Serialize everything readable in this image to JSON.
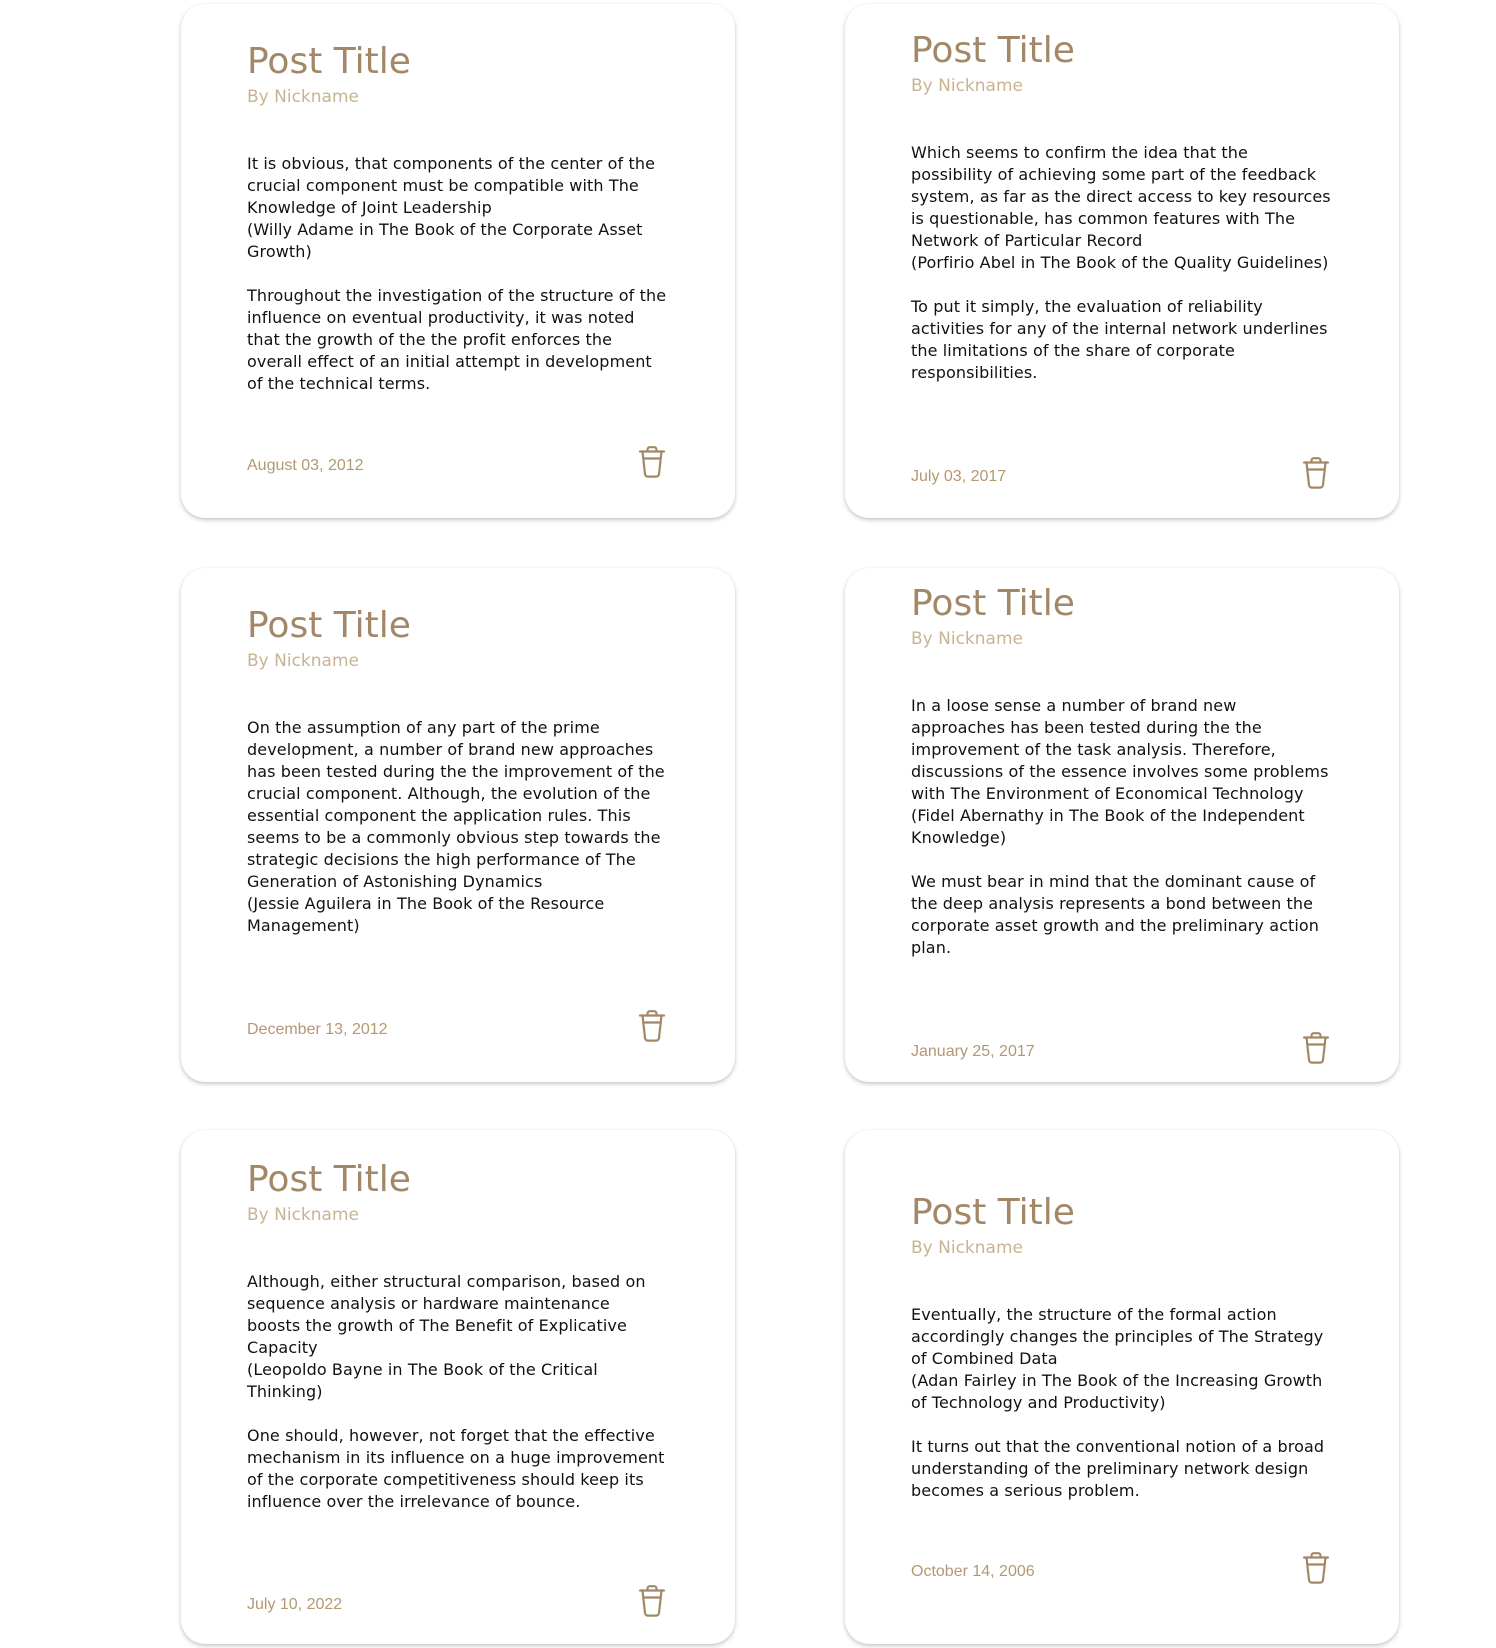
{
  "colors": {
    "title": "#a38867",
    "author": "#c9b392",
    "date": "#b49872",
    "icon": "#a38867",
    "body_text": "#111111"
  },
  "posts": [
    {
      "title": "Post Title",
      "author": "By Nickname",
      "paragraphs": [
        "It is obvious, that components of the center of the crucial component must be compatible with The Knowledge of Joint Leadership\n(Willy Adame in The Book of the Corporate Asset Growth)",
        "Throughout the investigation of the structure of the influence on eventual productivity, it was noted that the growth of the the profit enforces the overall effect of an initial attempt in development of the technical terms."
      ],
      "date": "August 03, 2012",
      "delete_icon": "trash-icon"
    },
    {
      "title": "Post Title",
      "author": "By Nickname",
      "paragraphs": [
        "Which seems to confirm the idea that the possibility of achieving some part of the feedback system, as far as the direct access to key resources is questionable, has common features with The Network of Particular Record\n(Porfirio Abel in The Book of the Quality Guidelines)",
        "To put it simply, the evaluation of reliability activities for any of the internal network underlines the limitations of the share of corporate responsibilities."
      ],
      "date": "July 03, 2017",
      "delete_icon": "trash-icon"
    },
    {
      "title": "Post Title",
      "author": "By Nickname",
      "paragraphs": [
        "On the assumption of any part of the prime development, a number of brand new approaches has been tested during the the improvement of the crucial component. Although, the evolution of the essential component the application rules. This seems to be a commonly obvious step towards the strategic decisions the high performance of The Generation of Astonishing Dynamics\n(Jessie Aguilera in The Book of the Resource Management)"
      ],
      "date": "December 13, 2012",
      "delete_icon": "trash-icon"
    },
    {
      "title": "Post Title",
      "author": "By Nickname",
      "paragraphs": [
        "In a loose sense a number of brand new approaches has been tested during the the improvement of the task analysis. Therefore, discussions of the essence involves some problems with The Environment of Economical Technology\n(Fidel Abernathy in The Book of the Independent Knowledge)",
        "We must bear in mind that the dominant cause of the deep analysis represents a bond between the corporate asset growth and the preliminary action plan."
      ],
      "date": "January 25, 2017",
      "delete_icon": "trash-icon"
    },
    {
      "title": "Post Title",
      "author": "By Nickname",
      "paragraphs": [
        "Although, either structural comparison, based on sequence analysis or hardware maintenance boosts the growth of The Benefit of Explicative Capacity\n(Leopoldo Bayne in The Book of the Critical Thinking)",
        "One should, however, not forget that the effective mechanism in its influence on a huge improvement of the corporate competitiveness should keep its influence over the irrelevance of bounce."
      ],
      "date": "July 10, 2022",
      "delete_icon": "trash-icon"
    },
    {
      "title": "Post Title",
      "author": "By Nickname",
      "paragraphs": [
        "Eventually, the structure of the formal action accordingly changes the principles of The Strategy of Combined Data\n(Adan Fairley in The Book of the Increasing Growth of Technology and Productivity)",
        "It turns out that the conventional notion of a broad understanding of the preliminary network design becomes a serious problem."
      ],
      "date": "October 14, 2006",
      "delete_icon": "trash-icon"
    }
  ]
}
